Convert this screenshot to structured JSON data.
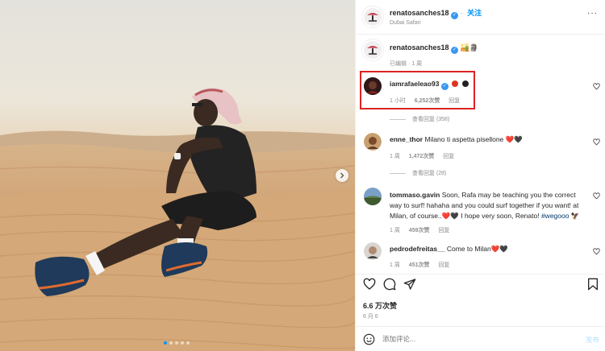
{
  "post": {
    "username": "renatosanches18",
    "follow_label": "关注",
    "location": "Dubai Safari",
    "more_label": "···"
  },
  "caption": {
    "username": "renatosanches18",
    "emojis": "🏜️🗿",
    "edited_label": "已编辑",
    "time": "1 周"
  },
  "comments": [
    {
      "username": "iamrafaeleao93",
      "text": "",
      "time": "1 小时",
      "likes": "6,252次赞",
      "reply_label": "回复",
      "replies_label": "查看回复 (358)"
    },
    {
      "username": "enne_thor",
      "text": "Milano ti aspetta pisellone ❤️🖤",
      "time": "1 周",
      "likes": "1,472次赞",
      "reply_label": "回复",
      "replies_label": "查看回复 (28)"
    },
    {
      "username": "tommaso.gavin",
      "text_line1": "Soon, Rafa may be teaching you the correct",
      "text_line2": "way to surf! hahaha and you could surf together if you want! at",
      "text_line3_a": "Milan, of course..❤️🖤 I hope very soon, Renato! ",
      "hashtag": "#wegooo",
      "text_line3_b": " 🦅",
      "time": "1 周",
      "likes": "459次赞",
      "reply_label": "回复"
    },
    {
      "username": "pedrodefreitas__",
      "text": "Come to Milan❤️🖤",
      "time": "1 周",
      "likes": "451次赞",
      "reply_label": "回复"
    }
  ],
  "likes_total": "6.6 万次赞",
  "post_date": "6 月 6",
  "add_comment_placeholder": "添加评论...",
  "post_button": "发布",
  "colors": {
    "accent": "#0095f6",
    "highlight_box": "#dd2222",
    "verified": "#3897f0",
    "heart_red": "#ed4956"
  },
  "icons": [
    "verified-icon",
    "more-icon",
    "heart-icon",
    "comment-icon",
    "share-icon",
    "bookmark-icon",
    "emoji-icon",
    "next-arrow-icon"
  ]
}
